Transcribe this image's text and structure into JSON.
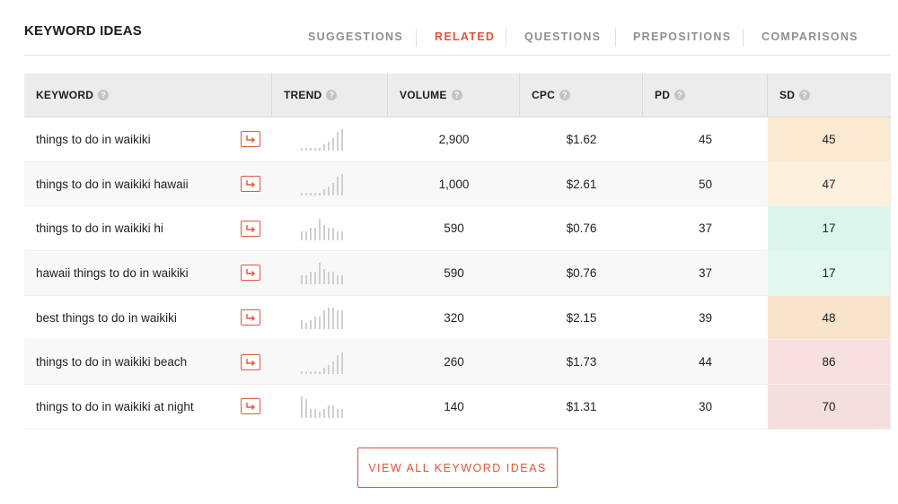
{
  "title": "KEYWORD IDEAS",
  "tabs": [
    {
      "label": "SUGGESTIONS",
      "active": false
    },
    {
      "label": "RELATED",
      "active": true
    },
    {
      "label": "QUESTIONS",
      "active": false
    },
    {
      "label": "PREPOSITIONS",
      "active": false
    },
    {
      "label": "COMPARISONS",
      "active": false
    }
  ],
  "columns": {
    "keyword": "KEYWORD",
    "trend": "TREND",
    "volume": "VOLUME",
    "cpc": "CPC",
    "pd": "PD",
    "sd": "SD"
  },
  "help_glyph": "?",
  "rows": [
    {
      "keyword": "things to do in waikiki",
      "volume": "2,900",
      "cpc": "$1.62",
      "pd": "45",
      "sd": "45",
      "sd_color": "#fbe9d2",
      "trend": [
        1,
        1,
        1,
        1,
        1,
        2,
        3,
        4,
        6,
        7
      ]
    },
    {
      "keyword": "things to do in waikiki hawaii",
      "volume": "1,000",
      "cpc": "$2.61",
      "pd": "50",
      "sd": "47",
      "sd_color": "#fdf0dc",
      "trend": [
        1,
        1,
        1,
        1,
        1,
        2,
        3,
        4,
        6,
        7
      ]
    },
    {
      "keyword": "things to do in waikiki hi",
      "volume": "590",
      "cpc": "$0.76",
      "pd": "37",
      "sd": "17",
      "sd_color": "#dcf5ec",
      "trend": [
        3,
        3,
        4,
        4,
        7,
        5,
        4,
        4,
        3,
        3
      ]
    },
    {
      "keyword": "hawaii things to do in waikiki",
      "volume": "590",
      "cpc": "$0.76",
      "pd": "37",
      "sd": "17",
      "sd_color": "#e1f7ef",
      "trend": [
        3,
        3,
        4,
        4,
        7,
        5,
        4,
        4,
        3,
        3
      ]
    },
    {
      "keyword": "best things to do in waikiki",
      "volume": "320",
      "cpc": "$2.15",
      "pd": "39",
      "sd": "48",
      "sd_color": "#f8e3cb",
      "trend": [
        3,
        2,
        3,
        4,
        4,
        6,
        7,
        7,
        6,
        6
      ]
    },
    {
      "keyword": "things to do in waikiki beach",
      "volume": "260",
      "cpc": "$1.73",
      "pd": "44",
      "sd": "86",
      "sd_color": "#f8e0e0",
      "trend": [
        1,
        1,
        1,
        1,
        1,
        2,
        3,
        4,
        6,
        7
      ]
    },
    {
      "keyword": "things to do in waikiki at night",
      "volume": "140",
      "cpc": "$1.31",
      "pd": "30",
      "sd": "70",
      "sd_color": "#f4dede",
      "trend": [
        7,
        6,
        3,
        3,
        2,
        3,
        4,
        4,
        3,
        3
      ]
    }
  ],
  "view_all_label": "VIEW ALL KEYWORD IDEAS",
  "colors": {
    "accent": "#e6503a",
    "spark": "#cfcfcf"
  }
}
